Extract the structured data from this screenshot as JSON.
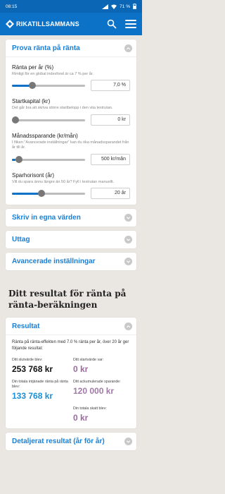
{
  "status": {
    "time": "08:15",
    "battery": "71 %"
  },
  "app": {
    "brand": "RIKATILLSAMMANS"
  },
  "calculator": {
    "title": "Prova ränta på ränta",
    "fields": [
      {
        "label": "Ränta per år (%)",
        "help": "Rimligt för en global indexfond är ca 7 % per år.",
        "value": "7,0 %",
        "level": 0.26
      },
      {
        "label": "Startkapital (kr)",
        "help": "Det går bra att skriva större startbelopp i den vita textrutan.",
        "value": "0 kr",
        "level": 0.0
      },
      {
        "label": "Månadssparande (kr/mån)",
        "help": "I fliken \"Avancerade inställningar\" kan du öka månadssparandet från år till år.",
        "value": "500 kr/mån",
        "level": 0.05
      },
      {
        "label": "Sparhorisont (år)",
        "help": "Vill du spara ännu längre än 50 år? Fyll i textrutan manuellt.",
        "value": "20 år",
        "level": 0.39
      }
    ]
  },
  "sections": [
    {
      "title": "Skriv in egna värden"
    },
    {
      "title": "Uttag"
    },
    {
      "title": "Avancerade inställningar"
    }
  ],
  "results": {
    "heading": "Ditt resultat för ränta på ränta-beräkningen",
    "card_title": "Resultat",
    "intro": "Ränta på ränta-effekten med 7.0 % ränta per år, över 20 år ger följande resultat:",
    "items": [
      {
        "label": "Ditt slutvärde blev:",
        "value": "253 768 kr",
        "color": "#111111"
      },
      {
        "label": "Ditt startvärde var:",
        "value": "0 kr",
        "color": "#9c6aa0"
      },
      {
        "label": "Din totala intjänade ränta på ränta blev:",
        "value": "133 768 kr",
        "color": "#1a8fd8"
      },
      {
        "label": "Ditt ackumulerade sparande:",
        "value": "120 000 kr",
        "color": "#a07ba6"
      },
      {
        "label": "Din totala skatt blev:",
        "value": "0 kr",
        "color": "#9c6aa0"
      }
    ],
    "detail_title": "Detaljerat resultat (år för år)"
  },
  "colors": {
    "brand": "#0b72c8",
    "accent_text": "#1a7fd4"
  },
  "icons": {
    "search": "search-icon",
    "menu": "hamburger-menu-icon",
    "chevron": "chevron-icon"
  }
}
